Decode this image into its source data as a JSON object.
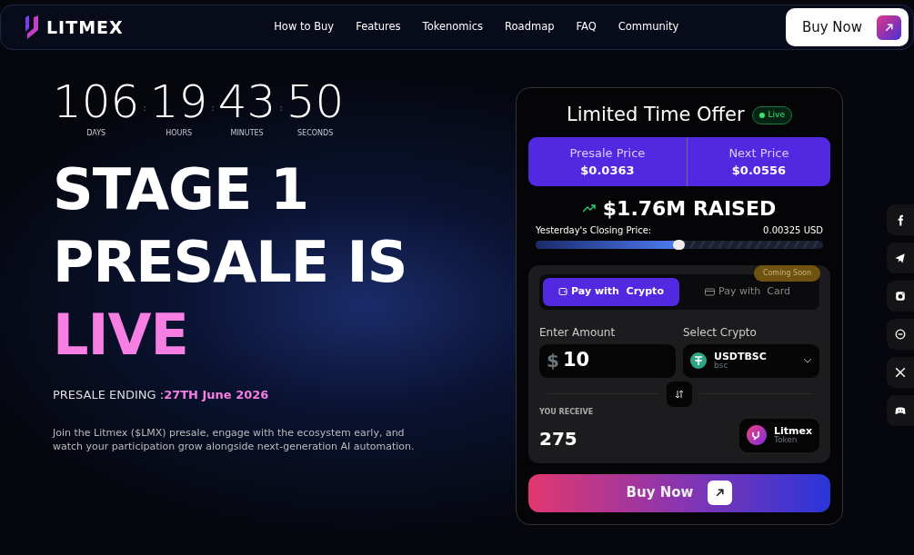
{
  "brand": "LITMEX",
  "nav": [
    {
      "label": "How to Buy"
    },
    {
      "label": "Features"
    },
    {
      "label": "Tokenomics"
    },
    {
      "label": "Roadmap"
    },
    {
      "label": "FAQ"
    },
    {
      "label": "Community"
    }
  ],
  "header_button": "Buy Now",
  "countdown_separator": ":",
  "countdown": [
    {
      "value": "106",
      "unit": "DAYS"
    },
    {
      "value": "19",
      "unit": "HOURS"
    },
    {
      "value": "43",
      "unit": "MINUTES"
    },
    {
      "value": "50",
      "unit": "SECONDS"
    }
  ],
  "headline": [
    "STAGE 1",
    "PRESALE IS"
  ],
  "headline_highlight": "LIVE",
  "ending_label": "PRESALE ENDING :",
  "ending_date": "27TH June 2026",
  "description": "Join the Litmex ($LMX) presale, engage with the ecosystem early, and watch your participation grow alongside next-generation AI automation.",
  "offer": {
    "title": "Limited Time Offer",
    "status": "Live",
    "prices": [
      {
        "label": "Presale Price",
        "value": "$0.0363"
      },
      {
        "label": "Next Price",
        "value": "$0.0556"
      }
    ],
    "raised": "$1.76M RAISED",
    "closing_label": "Yesterday's Closing Price:",
    "closing_value": "0.00325 USD",
    "level": 0.5,
    "pay_tabs": [
      {
        "label": "Pay with  Crypto",
        "selected": true
      },
      {
        "label": "Pay with  Card",
        "selected": false
      }
    ],
    "coming_soon": "Coming Soon",
    "amount_label": "Enter Amount",
    "currency_symbol": "$",
    "amount": "10",
    "crypto_label": "Select Crypto",
    "crypto_name": "USDTBSC",
    "crypto_network": "bsc",
    "receive_label": "YOU RECEIVE",
    "receive_amount": "275",
    "token_name": "Litmex",
    "token_type": "Token",
    "buy_button": "Buy Now"
  }
}
